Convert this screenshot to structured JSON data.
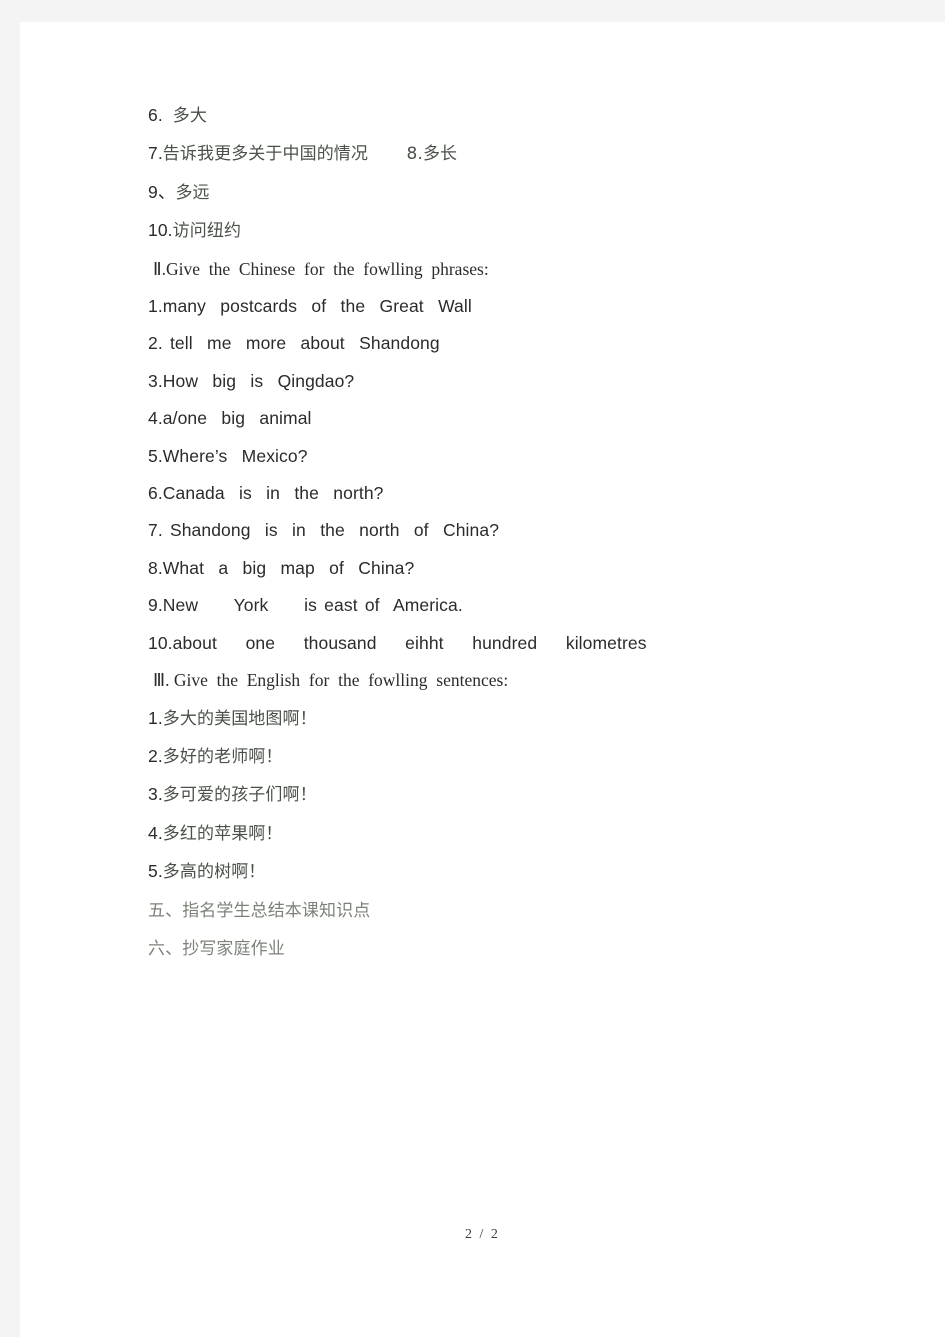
{
  "document": {
    "page_label": "2 / 2",
    "lines": [
      {
        "id": "l1",
        "num": "6.  ",
        "text": "多大",
        "script": "cn"
      },
      {
        "id": "l2",
        "num": "7.",
        "text": "告诉我更多关于中国的情况       8.多长",
        "script": "cn"
      },
      {
        "id": "l3",
        "num": "9、",
        "text": "多远",
        "script": "cn"
      },
      {
        "id": "l4",
        "num": "10.",
        "text": "访问纽约",
        "script": "cn"
      },
      {
        "id": "l5",
        "num": "",
        "text": "Ⅱ.Give  the  Chinese  for  the  fowlling  phrases:",
        "script": "head"
      },
      {
        "id": "l6",
        "num": "",
        "text": "1.many  postcards  of  the  Great  Wall",
        "script": "en"
      },
      {
        "id": "l7",
        "num": "",
        "text": "2. tell  me  more  about  Shandong",
        "script": "en"
      },
      {
        "id": "l8",
        "num": "",
        "text": "3.How  big  is  Qingdao?",
        "script": "en"
      },
      {
        "id": "l9",
        "num": "",
        "text": "4.a/one  big  animal",
        "script": "en"
      },
      {
        "id": "l10",
        "num": "",
        "text": "5.Where’s  Mexico?",
        "script": "en"
      },
      {
        "id": "l11",
        "num": "",
        "text": "6.Canada  is  in  the  north?",
        "script": "en"
      },
      {
        "id": "l12",
        "num": "",
        "text": "7. Shandong  is  in  the  north  of  China?",
        "script": "en"
      },
      {
        "id": "l13",
        "num": "",
        "text": "8.What  a  big  map  of  China?",
        "script": "en"
      },
      {
        "id": "l14",
        "num": "",
        "text": "9.New     York     is east of  America.",
        "script": "en"
      },
      {
        "id": "l15",
        "num": "",
        "text": "10.about    one    thousand    eihht    hundred    kilometres",
        "script": "en"
      },
      {
        "id": "l16",
        "num": "",
        "text": "Ⅲ. Give  the  English  for  the  fowlling  sentences:",
        "script": "head"
      },
      {
        "id": "l17",
        "num": "1.",
        "text": "多大的美国地图啊！",
        "script": "cn"
      },
      {
        "id": "l18",
        "num": "2.",
        "text": "多好的老师啊！",
        "script": "cn"
      },
      {
        "id": "l19",
        "num": "3.",
        "text": "多可爱的孩子们啊！",
        "script": "cn"
      },
      {
        "id": "l20",
        "num": "4.",
        "text": "多红的苹果啊！",
        "script": "cn"
      },
      {
        "id": "l21",
        "num": "5.",
        "text": "多高的树啊！",
        "script": "cn"
      },
      {
        "id": "l22",
        "num": "",
        "text": "五、指名学生总结本课知识点",
        "script": "cn-light"
      },
      {
        "id": "l23",
        "num": "",
        "text": "六、抄写家庭作业",
        "script": "cn-light"
      }
    ]
  },
  "colors": {
    "page_background": "#ffffff",
    "canvas_background": "#f4f4f4",
    "body_text": "#2b2b2b",
    "chinese_text": "#4a5248",
    "chinese_light_text": "#7b8378"
  }
}
